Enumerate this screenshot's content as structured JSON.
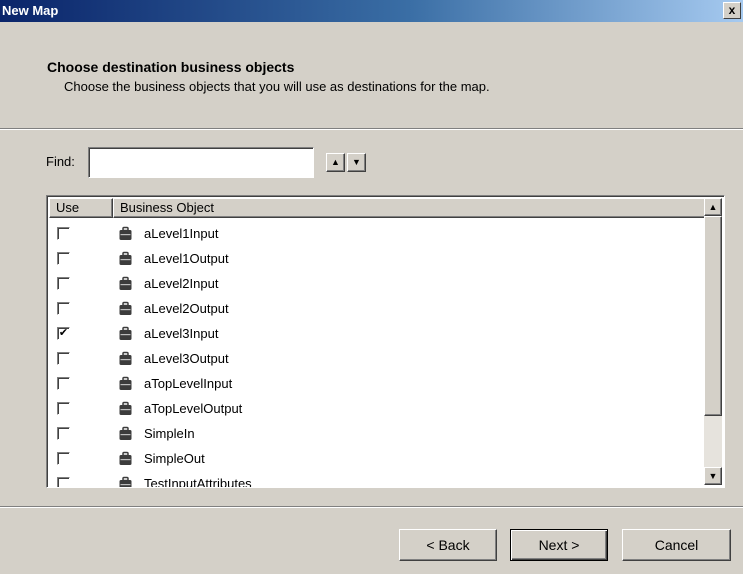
{
  "window": {
    "title": "New Map",
    "close_glyph": "x"
  },
  "header": {
    "title": "Choose destination business objects",
    "subtitle": "Choose the business objects that you will use as destinations for the map."
  },
  "find": {
    "label": "Find:",
    "value": "",
    "up_glyph": "▲",
    "down_glyph": "▼"
  },
  "list": {
    "columns": {
      "use": "Use",
      "business_object": "Business Object"
    },
    "items": [
      {
        "name": "aLevel1Input",
        "checked": false
      },
      {
        "name": "aLevel1Output",
        "checked": false
      },
      {
        "name": "aLevel2Input",
        "checked": false
      },
      {
        "name": "aLevel2Output",
        "checked": false
      },
      {
        "name": "aLevel3Input",
        "checked": true
      },
      {
        "name": "aLevel3Output",
        "checked": false
      },
      {
        "name": "aTopLevelInput",
        "checked": false
      },
      {
        "name": "aTopLevelOutput",
        "checked": false
      },
      {
        "name": "SimpleIn",
        "checked": false
      },
      {
        "name": "SimpleOut",
        "checked": false
      },
      {
        "name": "TestInputAttributes",
        "checked": false
      }
    ],
    "scroll_up_glyph": "▲",
    "scroll_down_glyph": "▼",
    "icon": "business-object-icon"
  },
  "buttons": {
    "back": "< Back",
    "next": "Next >",
    "cancel": "Cancel"
  },
  "colors": {
    "title_bar": "#0a246a",
    "dialog_bg": "#d4d0c8",
    "list_bg": "#ffffff"
  }
}
